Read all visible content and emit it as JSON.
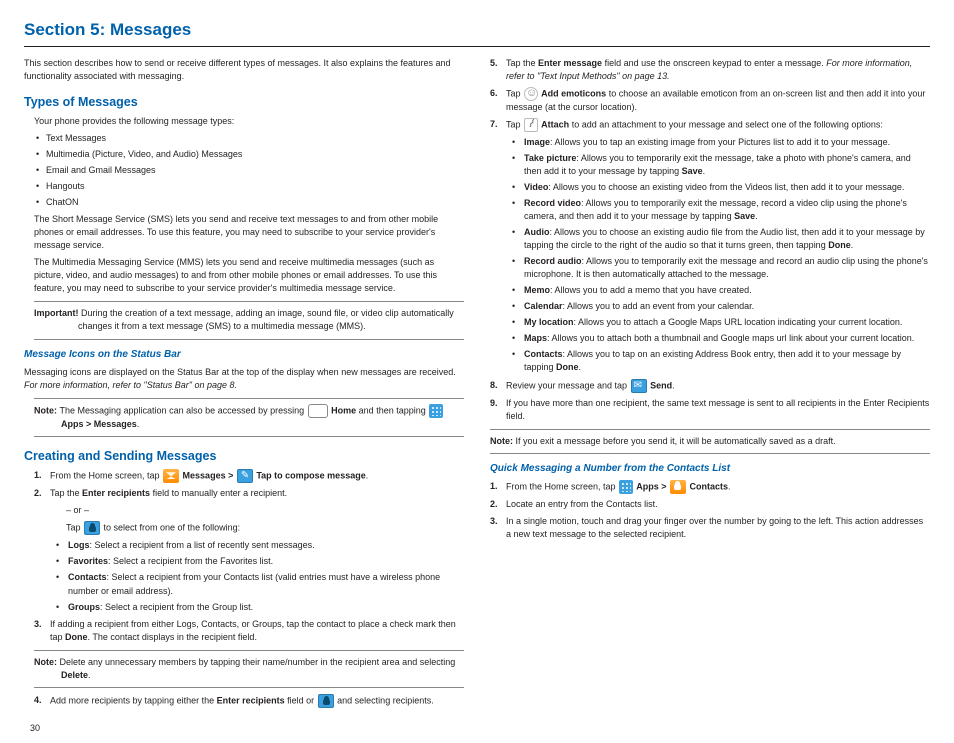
{
  "title": "Section 5: Messages",
  "intro": "This section describes how to send or receive different types of messages. It also explains the features and functionality associated with messaging.",
  "types": {
    "heading": "Types of Messages",
    "lead": "Your phone provides the following message types:",
    "items": [
      "Text Messages",
      "Multimedia (Picture, Video, and Audio) Messages",
      "Email and Gmail Messages",
      "Hangouts",
      "ChatON"
    ],
    "sms": "The Short Message Service (SMS) lets you send and receive text messages to and from other mobile phones or email addresses. To use this feature, you may need to subscribe to your service provider's message service.",
    "mms": "The Multimedia Messaging Service (MMS) lets you send and receive multimedia messages (such as picture, video, and audio messages) to and from other mobile phones or email addresses. To use this feature, you may need to subscribe to your service provider's multimedia message service."
  },
  "important": {
    "label": "Important! ",
    "text": "During the creation of a text message, adding an image, sound file, or video clip automatically changes it from a text message (SMS) to a multimedia message (MMS)."
  },
  "icons_status": {
    "heading": "Message Icons on the Status Bar",
    "p1": "Messaging icons are displayed on the Status Bar at the top of the display when new messages are received. ",
    "p1_ref": "For more information, refer to \"Status Bar\" on page 8."
  },
  "note1": {
    "label": "Note: ",
    "text_a": "The Messaging application can also be accessed by pressing ",
    "home": " Home",
    "text_b": " and then tapping ",
    "apps": " Apps > Messages",
    "dot": "."
  },
  "creating": {
    "heading": "Creating and Sending Messages",
    "step1_a": "From the Home screen, tap ",
    "step1_msg": " Messages > ",
    "step1_comp": " Tap to compose message",
    "step1_dot": ".",
    "step2_a": "Tap the ",
    "step2_b": "Enter recipients",
    "step2_c": " field to manually enter a recipient.",
    "or": "– or –",
    "tap_to_select": "Tap ",
    "tap_to_select_b": " to select from one of the following:",
    "sub": [
      {
        "label": "Logs",
        "text": ": Select a recipient from a list of recently sent messages."
      },
      {
        "label": "Favorites",
        "text": ": Select a recipient from the Favorites list."
      },
      {
        "label": "Contacts",
        "text": ": Select a recipient from your Contacts list (valid entries must have a wireless phone number or email address)."
      },
      {
        "label": "Groups",
        "text": ": Select a recipient from the Group list."
      }
    ],
    "step3_a": "If adding a recipient from either Logs, Contacts, or Groups, tap the contact to place a check mark then tap ",
    "step3_b": "Done",
    "step3_c": ". The contact displays in the recipient field."
  },
  "note2": {
    "label": "Note: ",
    "text_a": "Delete any unnecessary members by tapping their name/number in the recipient area and selecting ",
    "delete": "Delete",
    "dot": "."
  },
  "step4": {
    "a": "Add more recipients by tapping either the ",
    "b": "Enter recipients",
    "c": " field or ",
    "d": " and selecting recipients."
  },
  "right": {
    "step5_a": "Tap the ",
    "step5_b": "Enter message",
    "step5_c": " field and use the onscreen keypad to enter a message. ",
    "step5_ref": "For more information, refer to \"Text Input Methods\" on page 13.",
    "step6_a": "Tap ",
    "step6_b": " Add emoticons",
    "step6_c": " to choose an available emoticon from an on-screen list and then add it into your message (at the cursor location).",
    "step7_a": "Tap ",
    "step7_b": " Attach",
    "step7_c": " to add an attachment to your message and select one of the following options:",
    "attach": [
      {
        "label": "Image",
        "text": ": Allows you to tap an existing image from your Pictures list to add it to your message."
      },
      {
        "label": "Take picture",
        "text": ": Allows you to temporarily exit the message, take a photo with phone's camera, and then add it to your message by tapping ",
        "extra_b": "Save",
        "tail": "."
      },
      {
        "label": "Video",
        "text": ": Allows you to choose an existing video from the Videos list, then add it to your message."
      },
      {
        "label": "Record video",
        "text": ": Allows you to temporarily exit the message, record a video clip using the phone's camera, and then add it to your message by tapping ",
        "extra_b": "Save",
        "tail": "."
      },
      {
        "label": "Audio",
        "text": ": Allows you to choose an existing audio file from the Audio list, then add it to your message by tapping the circle to the right of the audio so that it turns green, then tapping ",
        "extra_b": "Done",
        "tail": "."
      },
      {
        "label": "Record audio",
        "text": ": Allows you to temporarily exit the message and record an audio clip using the phone's microphone. It is then automatically attached to the message."
      },
      {
        "label": "Memo",
        "text": ": Allows you to add a memo that you have created."
      },
      {
        "label": "Calendar",
        "text": ": Allows you to add an event from your calendar."
      },
      {
        "label": "My location",
        "text": ": Allows you to attach a Google Maps URL location indicating your current location."
      },
      {
        "label": "Maps",
        "text": ": Allows you to attach both a thumbnail and Google maps url link about your current location."
      },
      {
        "label": "Contacts",
        "text": ": Allows you to tap on an existing Address Book entry, then add it to your message by tapping ",
        "extra_b": "Done",
        "tail": "."
      }
    ],
    "step8_a": "Review your message and tap ",
    "step8_b": " Send",
    "step8_c": ".",
    "step9": "If you have more than one recipient, the same text message is sent to all recipients in the Enter Recipients field."
  },
  "note3": {
    "label": "Note: ",
    "text": "If you exit a message before you send it, it will be automatically saved as a draft."
  },
  "quick": {
    "heading": "Quick Messaging a Number from the Contacts List",
    "step1_a": "From the Home screen, tap ",
    "step1_apps": " Apps > ",
    "step1_contacts": " Contacts",
    "step1_dot": ".",
    "step2": "Locate an entry from the Contacts list.",
    "step3": "In a single motion, touch and drag your finger over the number by going to the left. This action addresses a new text message to the selected recipient."
  },
  "page_num": "30"
}
